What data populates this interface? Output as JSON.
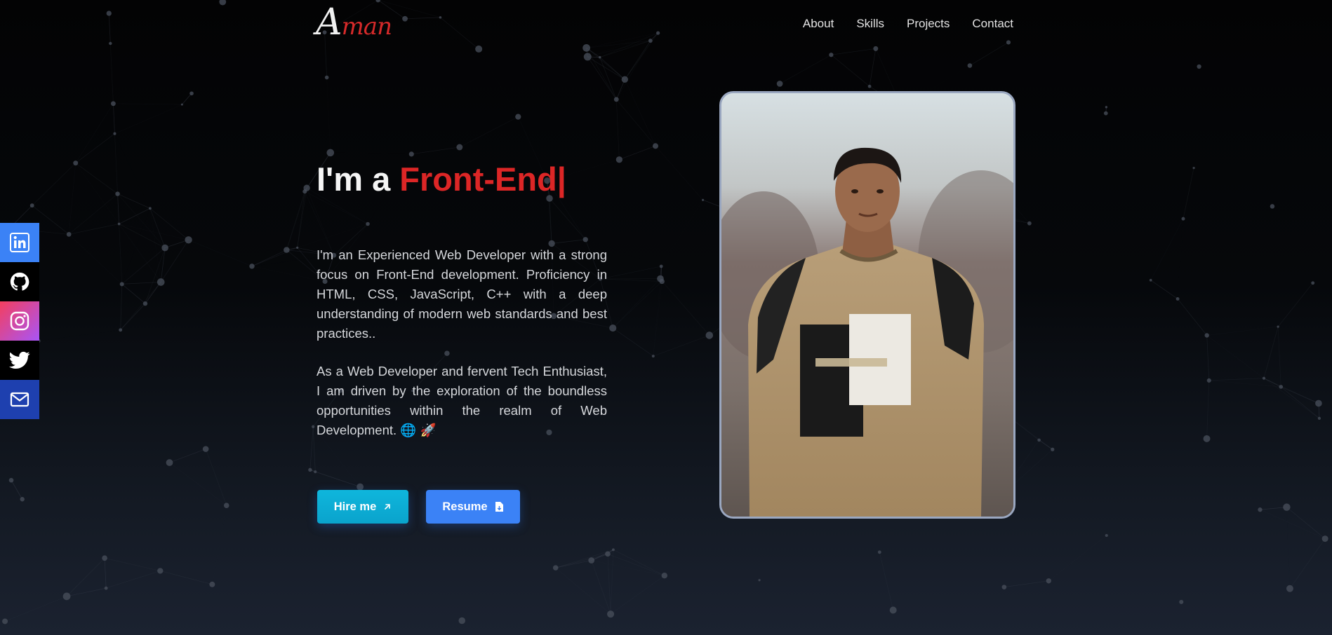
{
  "logo": {
    "text_1": "A",
    "text_2": "man"
  },
  "nav": {
    "items": [
      "About",
      "Skills",
      "Projects",
      "Contact"
    ]
  },
  "hero": {
    "prefix": "I'm a ",
    "highlight": "Front-End|",
    "paragraph_1": "I'm an Experienced Web Developer with a strong focus on Front-End development. Proficiency in HTML, CSS, JavaScript, C++ with a deep understanding of modern web standards and best practices..",
    "paragraph_2": "As a Web Developer and fervent Tech Enthusiast, I am driven by the exploration of the boundless opportunities within the realm of Web Development. 🌐 🚀",
    "hire_label": "Hire me",
    "resume_label": "Resume"
  },
  "social": {
    "icons": [
      "linkedin-icon",
      "github-icon",
      "instagram-icon",
      "twitter-icon",
      "mail-icon"
    ]
  },
  "colors": {
    "accent": "#dc2626",
    "hire_button": "#06b6d4",
    "resume_button": "#3b82f6",
    "photo_border": "#9aa7c0"
  }
}
